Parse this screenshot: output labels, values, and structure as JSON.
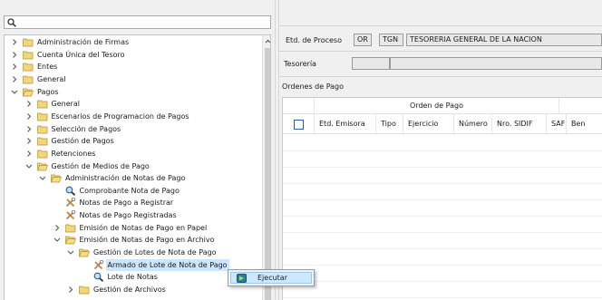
{
  "tree": {
    "items": [
      {
        "label": "Administración de Firmas",
        "depth": 0,
        "expanded": false,
        "icon": "folder-icon"
      },
      {
        "label": "Cuenta Única del Tesoro",
        "depth": 0,
        "expanded": false,
        "icon": "folder-icon"
      },
      {
        "label": "Entes",
        "depth": 0,
        "expanded": false,
        "icon": "folder-icon"
      },
      {
        "label": "General",
        "depth": 0,
        "expanded": false,
        "icon": "folder-icon"
      },
      {
        "label": "Pagos",
        "depth": 0,
        "expanded": true,
        "icon": "folder-icon"
      },
      {
        "label": "General",
        "depth": 1,
        "expanded": false,
        "icon": "folder-icon"
      },
      {
        "label": "Escenarios de Programacion de Pagos",
        "depth": 1,
        "expanded": false,
        "icon": "folder-icon"
      },
      {
        "label": "Selección de Pagos",
        "depth": 1,
        "expanded": false,
        "icon": "folder-icon"
      },
      {
        "label": "Gestión de Pagos",
        "depth": 1,
        "expanded": false,
        "icon": "folder-icon"
      },
      {
        "label": "Retenciones",
        "depth": 1,
        "expanded": false,
        "icon": "folder-icon"
      },
      {
        "label": "Gestión de Medios de Pago",
        "depth": 1,
        "expanded": true,
        "icon": "folder-icon"
      },
      {
        "label": "Administración de Notas de Pago",
        "depth": 2,
        "expanded": true,
        "icon": "folder-icon"
      },
      {
        "label": "Comprobante Nota de Pago",
        "depth": 3,
        "icon": "magnifier-icon"
      },
      {
        "label": "Notas de Pago a Registrar",
        "depth": 3,
        "icon": "tools-icon"
      },
      {
        "label": "Notas de Pago Registradas",
        "depth": 3,
        "icon": "tools-icon"
      },
      {
        "label": "Emisión de Notas de Pago en Papel",
        "depth": 3,
        "expanded": false,
        "icon": "folder-icon"
      },
      {
        "label": "Emisión de Notas de Pago en Archivo",
        "depth": 3,
        "expanded": true,
        "icon": "folder-icon"
      },
      {
        "label": "Gestión de Lotes de Nota de Pago",
        "depth": 4,
        "expanded": true,
        "icon": "folder-icon"
      },
      {
        "label": "Armado de Lote de Nota de Pago",
        "depth": 5,
        "icon": "tools-icon",
        "selected": true
      },
      {
        "label": "Lote de Notas",
        "depth": 5,
        "icon": "magnifier-icon"
      },
      {
        "label": "Gestión de Archivos",
        "depth": 4,
        "expanded": false,
        "icon": "folder-icon"
      }
    ]
  },
  "header": {
    "etd_proceso_label": "Etd. de Proceso",
    "etd_code1": "OR",
    "etd_code2": "TGN",
    "etd_name": "TESORERIA GENERAL DE LA NACION",
    "tesoreria_label": "Tesorería",
    "tesoreria_code": "",
    "tesoreria_name": ""
  },
  "ordenes": {
    "section_label": "Ordenes de Pago",
    "group_header": "Orden de Pago",
    "columns": [
      "Etd. Emisora",
      "Tipo",
      "Ejercicio",
      "Número",
      "Nro. SIDIF",
      "SAF",
      "Ben"
    ]
  },
  "context_menu": {
    "items": [
      {
        "label": "Ejecutar",
        "icon": "execute-icon"
      }
    ]
  },
  "colors": {
    "selection": "#cce6ff",
    "folder": "#e8c15a",
    "checkbox_border": "#2f5f9e"
  }
}
